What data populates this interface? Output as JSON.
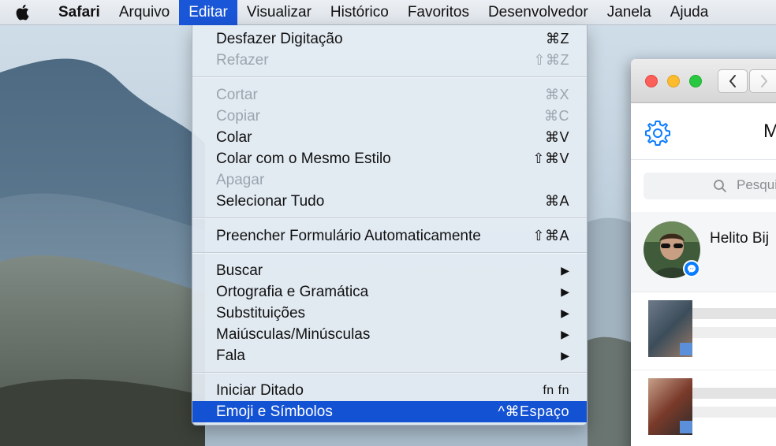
{
  "menubar": {
    "app_name": "Safari",
    "items": [
      "Arquivo",
      "Editar",
      "Visualizar",
      "Histórico",
      "Favoritos",
      "Desenvolvedor",
      "Janela",
      "Ajuda"
    ],
    "active_item": "Editar"
  },
  "edit_menu": {
    "groups": [
      [
        {
          "label": "Desfazer Digitação",
          "shortcut": "⌘Z",
          "enabled": true
        },
        {
          "label": "Refazer",
          "shortcut": "⇧⌘Z",
          "enabled": false
        }
      ],
      [
        {
          "label": "Cortar",
          "shortcut": "⌘X",
          "enabled": false
        },
        {
          "label": "Copiar",
          "shortcut": "⌘C",
          "enabled": false
        },
        {
          "label": "Colar",
          "shortcut": "⌘V",
          "enabled": true
        },
        {
          "label": "Colar com o Mesmo Estilo",
          "shortcut": "⇧⌘V",
          "enabled": true
        },
        {
          "label": "Apagar",
          "shortcut": "",
          "enabled": false
        },
        {
          "label": "Selecionar Tudo",
          "shortcut": "⌘A",
          "enabled": true
        }
      ],
      [
        {
          "label": "Preencher Formulário Automaticamente",
          "shortcut": "⇧⌘A",
          "enabled": true
        }
      ],
      [
        {
          "label": "Buscar",
          "submenu": true,
          "enabled": true
        },
        {
          "label": "Ortografia e Gramática",
          "submenu": true,
          "enabled": true
        },
        {
          "label": "Substituições",
          "submenu": true,
          "enabled": true
        },
        {
          "label": "Maiúsculas/Minúsculas",
          "submenu": true,
          "enabled": true
        },
        {
          "label": "Fala",
          "submenu": true,
          "enabled": true
        }
      ],
      [
        {
          "label": "Iniciar Ditado",
          "shortcut": "fn fn",
          "enabled": true
        },
        {
          "label": "Emoji e Símbolos",
          "shortcut": "^⌘Espaço",
          "enabled": true,
          "highlighted": true
        }
      ]
    ],
    "submenu_glyph": "▶"
  },
  "messenger": {
    "title": "M",
    "search_placeholder": "Pesquisa",
    "contact_name": "Helito Bij"
  },
  "colors": {
    "menu_highlight": "#1452d4",
    "messenger_blue": "#0a7cff"
  },
  "icons": {
    "apple": "apple-logo-icon",
    "gear": "gear-icon",
    "search": "search-icon",
    "back": "chevron-left-icon",
    "forward": "chevron-right-icon",
    "badge": "messenger-icon"
  }
}
